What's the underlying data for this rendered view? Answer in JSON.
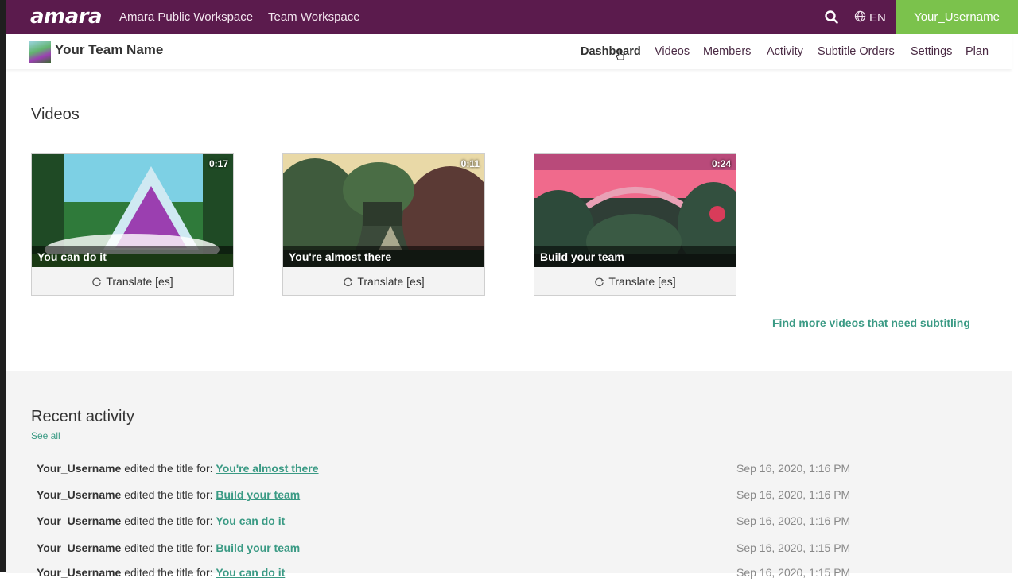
{
  "topbar": {
    "logo": "amara",
    "links": [
      "Amara Public Workspace",
      "Team Workspace"
    ],
    "language": "EN",
    "username": "Your_Username",
    "colors": {
      "bar": "#5b1b4d",
      "user_button": "#7bc24c"
    }
  },
  "team": {
    "name": "Your Team Name",
    "tabs": [
      "Dashboard",
      "Videos",
      "Members",
      "Activity",
      "Subtitle Orders",
      "Settings",
      "Plan"
    ],
    "active_tab": "Dashboard"
  },
  "videos": {
    "heading": "Videos",
    "items": [
      {
        "title": "You can do it",
        "duration": "0:17",
        "action": "Translate [es]"
      },
      {
        "title": "You're almost there",
        "duration": "0:11",
        "action": "Translate [es]"
      },
      {
        "title": "Build your team",
        "duration": "0:24",
        "action": "Translate [es]"
      }
    ],
    "find_more": "Find more videos that need subtitling"
  },
  "activity": {
    "heading": "Recent activity",
    "see_all": "See all",
    "items": [
      {
        "user": "Your_Username",
        "text": "edited the title for:",
        "link": "You're almost there",
        "date": "Sep 16, 2020, 1:16 PM"
      },
      {
        "user": "Your_Username",
        "text": "edited the title for:",
        "link": "Build your team",
        "date": "Sep 16, 2020, 1:16 PM"
      },
      {
        "user": "Your_Username",
        "text": "edited the title for:",
        "link": "You can do it",
        "date": "Sep 16, 2020, 1:16 PM"
      },
      {
        "user": "Your_Username",
        "text": "edited the title for:",
        "link": "Build your team",
        "date": "Sep 16, 2020, 1:15 PM"
      },
      {
        "user": "Your_Username",
        "text": "edited the title for:",
        "link": "You can do it",
        "date": "Sep 16, 2020, 1:15 PM"
      }
    ],
    "link_color": "#3a9a84"
  },
  "icons": [
    "search-icon",
    "globe-icon",
    "translate-icon",
    "cursor-icon"
  ]
}
